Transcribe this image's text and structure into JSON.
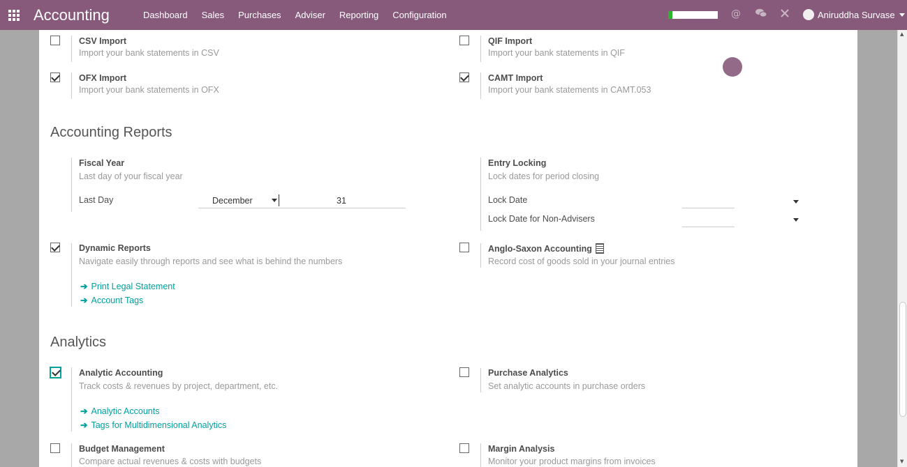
{
  "navbar": {
    "brand": "Accounting",
    "menu": [
      "Dashboard",
      "Sales",
      "Purchases",
      "Adviser",
      "Reporting",
      "Configuration"
    ],
    "user_name": "Aniruddha Survase",
    "progress_fraction": 0.08,
    "accent": "#875a7b"
  },
  "bank_import": {
    "csv": {
      "title": "CSV Import",
      "desc": "Import your bank statements in CSV",
      "checked": false
    },
    "qif": {
      "title": "QIF Import",
      "desc": "Import your bank statements in QIF",
      "checked": false
    },
    "ofx": {
      "title": "OFX Import",
      "desc": "Import your bank statements in OFX",
      "checked": true
    },
    "camt": {
      "title": "CAMT Import",
      "desc": "Import your bank statements in CAMT.053",
      "checked": true
    }
  },
  "accounting_reports": {
    "heading": "Accounting Reports",
    "fiscal_year": {
      "title": "Fiscal Year",
      "desc": "Last day of your fiscal year",
      "last_day_label": "Last Day",
      "month": "December",
      "day": "31"
    },
    "entry_locking": {
      "title": "Entry Locking",
      "desc": "Lock dates for period closing",
      "lock_date_label": "Lock Date",
      "lock_date_non_advisers_label": "Lock Date for Non-Advisers"
    },
    "dynamic_reports": {
      "title": "Dynamic Reports",
      "desc": "Navigate easily through reports and see what is behind the numbers",
      "checked": true,
      "links": [
        "Print Legal Statement",
        "Account Tags"
      ]
    },
    "anglo_saxon": {
      "title": "Anglo-Saxon Accounting",
      "desc": "Record cost of goods sold in your journal entries",
      "checked": false
    }
  },
  "analytics": {
    "heading": "Analytics",
    "analytic_accounting": {
      "title": "Analytic Accounting",
      "desc": "Track costs & revenues by project, department, etc.",
      "checked": true,
      "links": [
        "Analytic Accounts",
        "Tags for Multidimensional Analytics"
      ]
    },
    "purchase_analytics": {
      "title": "Purchase Analytics",
      "desc": "Set analytic accounts in purchase orders",
      "checked": false
    },
    "budget_management": {
      "title": "Budget Management",
      "desc": "Compare actual revenues & costs with budgets",
      "checked": false
    },
    "margin_analysis": {
      "title": "Margin Analysis",
      "desc": "Monitor your product margins from invoices",
      "checked": false
    }
  }
}
